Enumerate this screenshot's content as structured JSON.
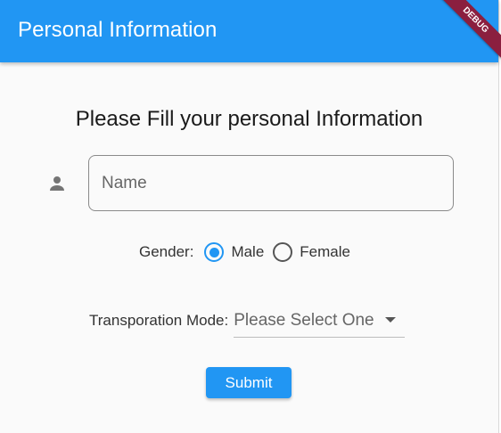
{
  "appbar": {
    "title": "Personal Information",
    "debug_banner": "DEBUG"
  },
  "form": {
    "heading": "Please Fill your personal Information",
    "name_field": {
      "placeholder": "Name",
      "icon": "person-icon"
    },
    "gender": {
      "label": "Gender:",
      "options": [
        "Male",
        "Female"
      ],
      "selected": "Male"
    },
    "transportation": {
      "label": "Transporation Mode:",
      "placeholder": "Please Select One"
    },
    "submit_label": "Submit"
  },
  "colors": {
    "primary": "#2196f3",
    "debug_banner": "#8b1f3f"
  }
}
